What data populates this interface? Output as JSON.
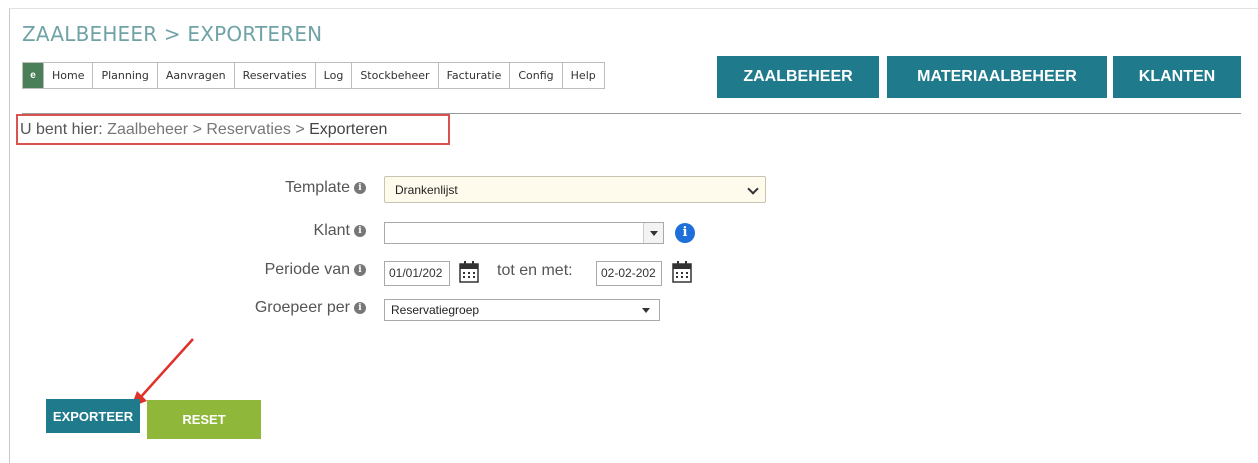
{
  "page_title": "ZAALBEHEER > EXPORTEREN",
  "nav": {
    "logo_text": "e",
    "items": [
      "Home",
      "Planning",
      "Aanvragen",
      "Reservaties",
      "Log",
      "Stockbeheer",
      "Facturatie",
      "Config",
      "Help"
    ]
  },
  "modules": {
    "zaalbeheer": "ZAALBEHEER",
    "materiaalbeheer": "MATERIAALBEHEER",
    "klanten": "KLANTEN"
  },
  "breadcrumb": {
    "prefix": "U bent hier:",
    "link1": "Zaalbeheer",
    "sep": ">",
    "link2": "Reservaties",
    "current": "Exporteren"
  },
  "form": {
    "template_label": "Template",
    "template_value": "Drankenlijst",
    "klant_label": "Klant",
    "klant_value": "",
    "periode_label": "Periode van",
    "periode_from": "01/01/202",
    "tot_label": "tot en met:",
    "periode_to": "02-02-202",
    "groepeer_label": "Groepeer per",
    "groepeer_value": "Reservatiegroep"
  },
  "buttons": {
    "exporteer": "EXPORTEER",
    "reset": "RESET"
  },
  "colors": {
    "accent": "#1f7a8c",
    "title": "#6fa3a6",
    "reset": "#8fb83a",
    "highlight": "#d9534f"
  }
}
